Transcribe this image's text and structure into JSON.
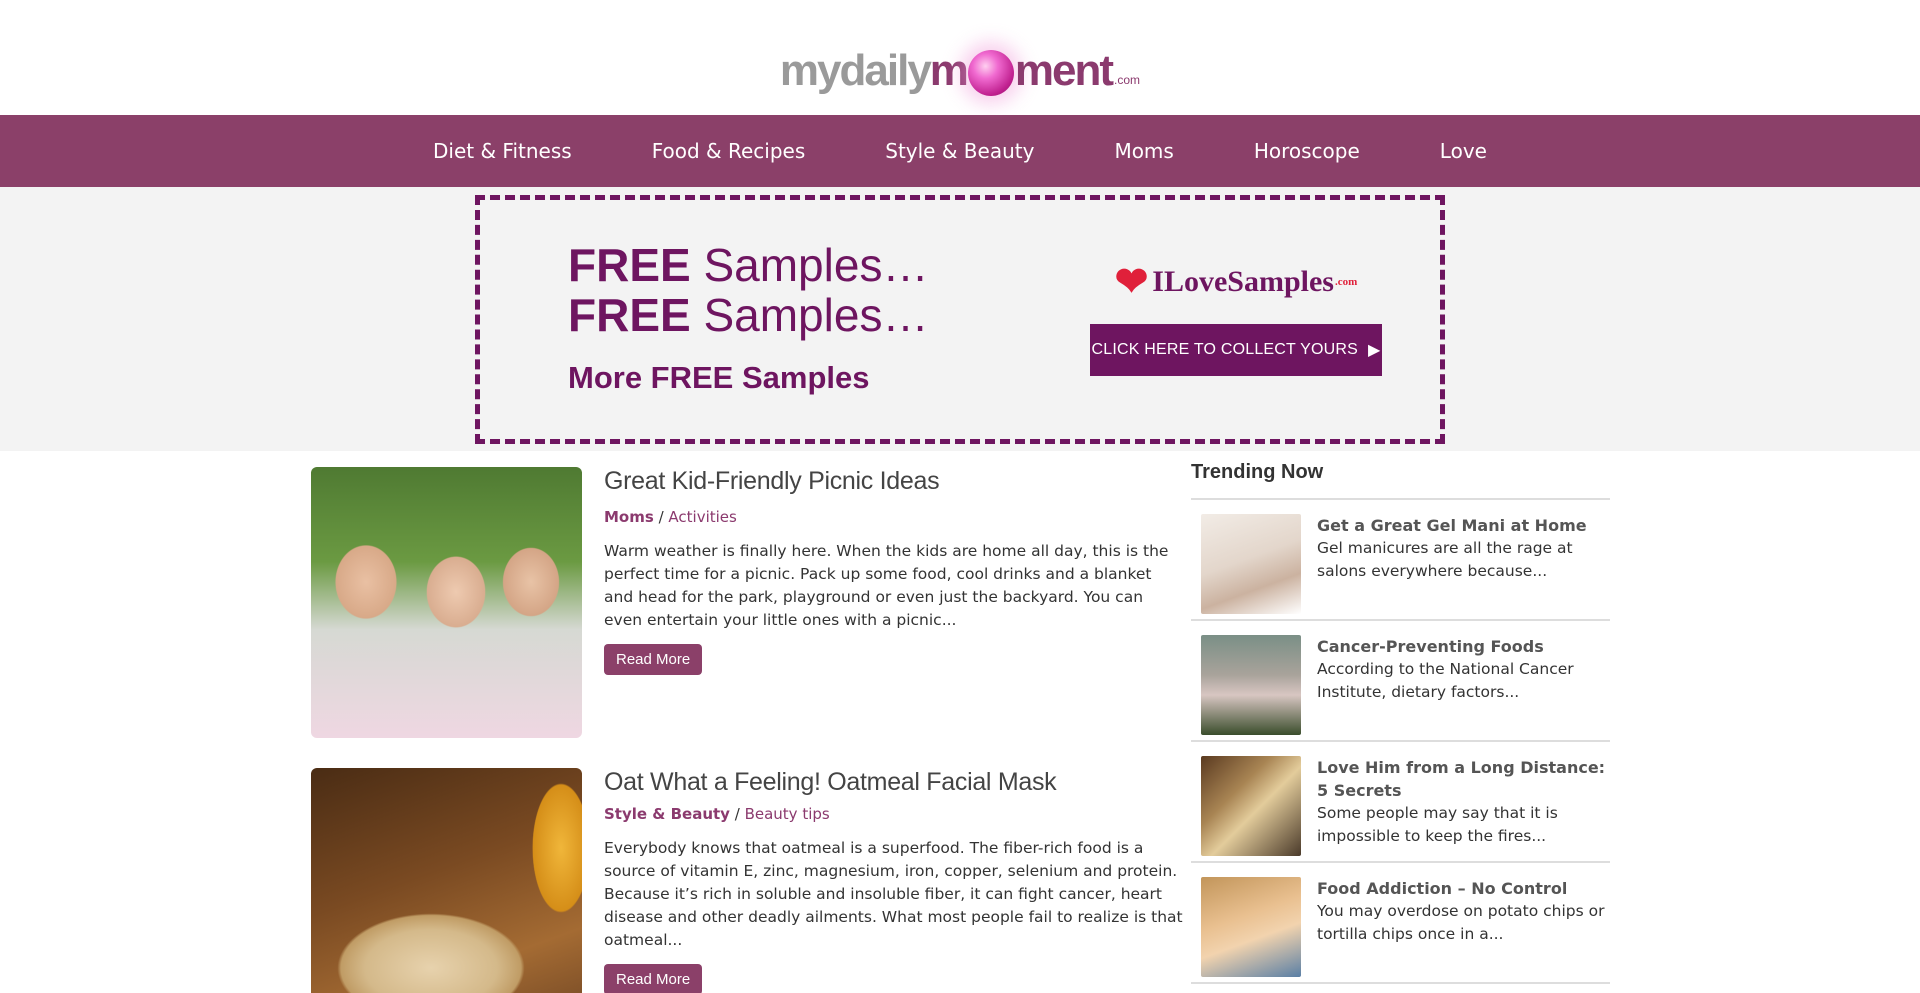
{
  "logo": {
    "part1": "mydaily",
    "part2": "m",
    "part3": "ment",
    "suffix": ".com"
  },
  "nav": [
    "Diet & Fitness",
    "Food & Recipes",
    "Style & Beauty",
    "Moms",
    "Horoscope",
    "Love"
  ],
  "ad": {
    "line1_bold": "FREE",
    "line1_rest": "Samples…",
    "line2_bold": "FREE",
    "line2_rest": "Samples…",
    "line3": "More FREE Samples",
    "brand": "ILoveSamples",
    "brand_suffix": ".com",
    "cta": "CLICK HERE TO COLLECT YOURS",
    "colors": {
      "primary": "#6e1560",
      "heart": "#e0203a"
    }
  },
  "articles": [
    {
      "title": "Great Kid-Friendly Picnic Ideas",
      "category": "Moms",
      "subcategory": "Activities",
      "excerpt": "Warm weather is finally here. When the kids are home all day, this is the perfect time for a picnic. Pack up some food, cool drinks and a blanket and head for the park, playground or even just the backyard. You can even entertain your little ones with a picnic...",
      "button": "Read More"
    },
    {
      "title": "Oat What a Feeling! Oatmeal Facial Mask",
      "category": "Style & Beauty",
      "subcategory": "Beauty tips",
      "excerpt": "Everybody knows that oatmeal is a superfood. The fiber-rich food is a source of vitamin E, zinc, magnesium, iron, copper, selenium and protein. Because it’s rich in soluble and insoluble fiber, it can fight cancer, heart disease and other deadly ailments. What most people fail to realize is that oatmeal...",
      "button": "Read More"
    }
  ],
  "sidebar": {
    "title": "Trending Now",
    "items": [
      {
        "title": "Get a Great Gel Mani at Home",
        "desc": "Gel manicures are all the rage at salons everywhere because..."
      },
      {
        "title": "Cancer-Preventing Foods",
        "desc": "According to the National Cancer Institute, dietary factors..."
      },
      {
        "title": "Love Him from a Long Distance: 5 Secrets",
        "desc": "Some people may say that it is impossible to keep the fires..."
      },
      {
        "title": "Food Addiction – No Control",
        "desc": "You may overdose on potato chips or tortilla chips once in a..."
      }
    ]
  },
  "theme": {
    "accent": "#8b4069",
    "nav_bg": "#8b4069"
  }
}
